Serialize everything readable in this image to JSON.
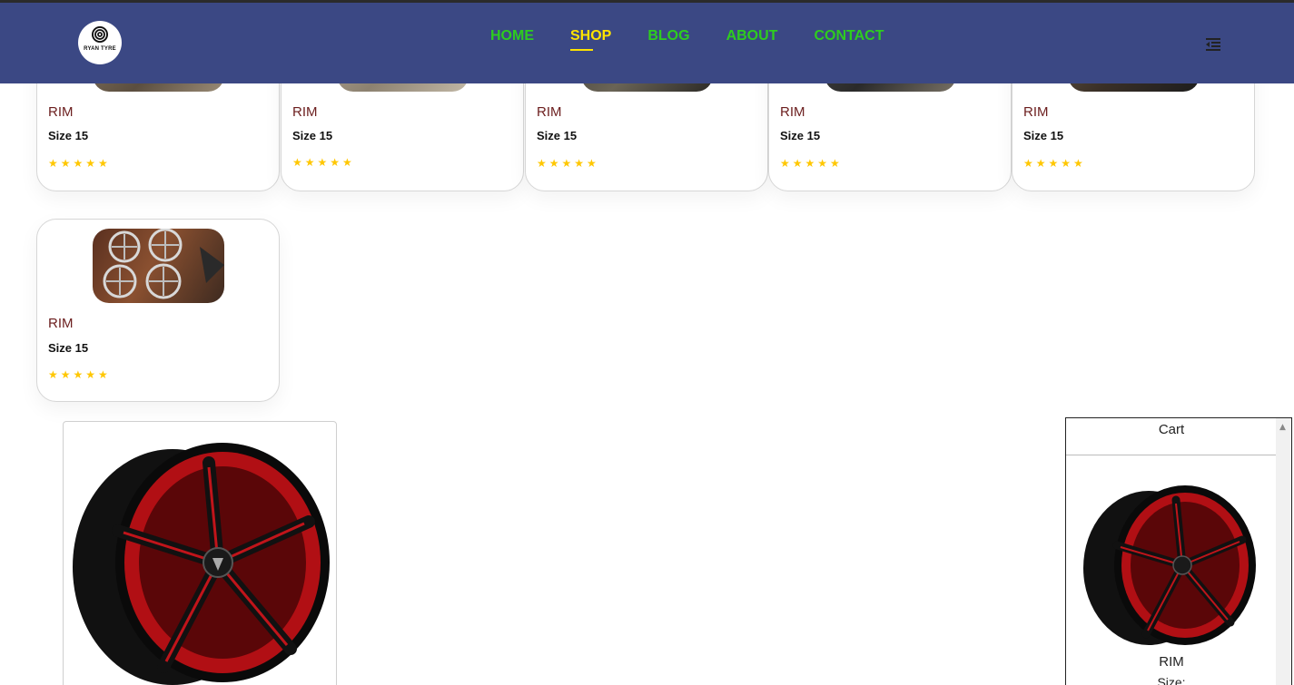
{
  "brand": {
    "name": "RYAN TYRE",
    "colors": {
      "nav_bg": "#3b4884",
      "nav_link": "#2ecc1f",
      "nav_active": "#ffe300",
      "star": "#ffc700",
      "product_name": "#6b1d1d"
    }
  },
  "nav": {
    "items": [
      {
        "label": "HOME"
      },
      {
        "label": "SHOP",
        "active": true
      },
      {
        "label": "BLOG"
      },
      {
        "label": "ABOUT"
      },
      {
        "label": "CONTACT"
      }
    ],
    "menu_icon": "menu-indent-icon"
  },
  "products": [
    {
      "name": "RIM",
      "size": "Size 15",
      "rating": 5,
      "stars": "★★★★★"
    },
    {
      "name": "RIM",
      "size": "Size 15",
      "rating": 5,
      "stars": "★★★★★"
    },
    {
      "name": "RIM",
      "size": "Size 15",
      "rating": 5,
      "stars": "★★★★★"
    },
    {
      "name": "RIM",
      "size": "Size 15",
      "rating": 5,
      "stars": "★★★★★"
    },
    {
      "name": "RIM",
      "size": "Size 15",
      "rating": 5,
      "stars": "★★★★★"
    },
    {
      "name": "RIM",
      "size": "Size 15",
      "rating": 5,
      "stars": "★★★★★"
    }
  ],
  "cart": {
    "title": "Cart",
    "items": [
      {
        "name": "RIM",
        "size_label": "Size:"
      }
    ]
  }
}
